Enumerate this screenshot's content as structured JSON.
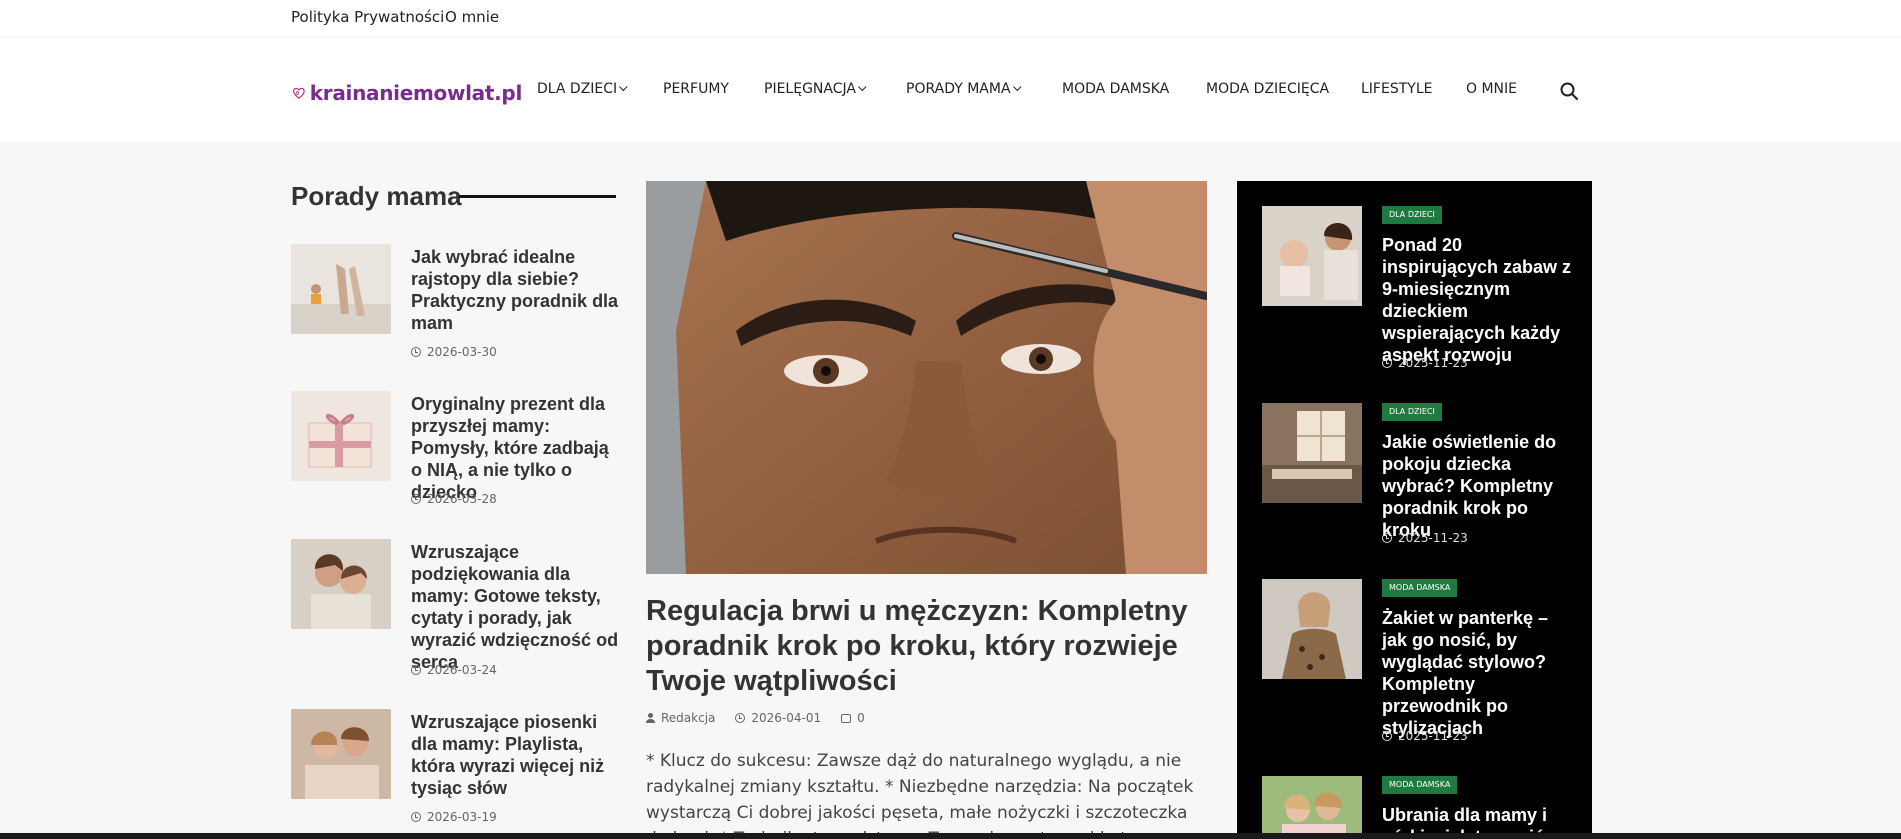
{
  "topbar": {
    "links": [
      "Polityka Prywatności",
      "O mnie"
    ]
  },
  "header": {
    "logo_text": "krainaniemowlat.pl",
    "nav": [
      {
        "label": "DLA DZIECI",
        "dropdown": true
      },
      {
        "label": "PERFUMY",
        "dropdown": false
      },
      {
        "label": "PIELĘGNACJA",
        "dropdown": true
      },
      {
        "label": "PORADY MAMA",
        "dropdown": true
      },
      {
        "label": "MODA DAMSKA",
        "dropdown": false
      },
      {
        "label": "MODA DZIECIĘCA",
        "dropdown": false
      },
      {
        "label": "LIFESTYLE",
        "dropdown": false
      },
      {
        "label": "O MNIE",
        "dropdown": false
      }
    ],
    "search_icon": "search-icon"
  },
  "left": {
    "section_title": "Porady mama",
    "items": [
      {
        "title": "Jak wybrać idealne rajstopy dla siebie? Praktyczny poradnik dla mam",
        "date": "2026-03-30"
      },
      {
        "title": "Oryginalny prezent dla przyszłej mamy: Pomysły, które zadbają o NIĄ, a nie tylko o dziecko",
        "date": "2026-03-28"
      },
      {
        "title": "Wzruszające podziękowania dla mamy: Gotowe teksty, cytaty i porady, jak wyrazić wdzięczność od serca",
        "date": "2026-03-24"
      },
      {
        "title": "Wzruszające piosenki dla mamy: Playlista, która wyrazi więcej niż tysiąc słów",
        "date": "2026-03-19"
      }
    ]
  },
  "main": {
    "title": "Regulacja brwi u mężczyzn: Kompletny poradnik krok po kroku, który rozwieje Twoje wątpliwości",
    "author": "Redakcja",
    "date": "2026-04-01",
    "comments": "0",
    "excerpt": "* Klucz do sukcesu: Zawsze dąż do naturalnego wyglądu, a nie radykalnej zmiany kształtu. * Niezbędne narzędzia: Na początek wystarczą Ci dobrej jakości pęseta, małe nożyczki i szczoteczka do brwi. * Technika to podstawa: Trzymaj pęsetę pod kątem, wyrywaj pojedyncze włoski zgodnie z kierunkiem ich wzrostu."
  },
  "side": {
    "items": [
      {
        "badge": "DLA DZIECI",
        "title": "Ponad 20 inspirujących zabaw z 9-miesięcznym dzieckiem wspierających każdy aspekt rozwoju",
        "date": "2025-11-23"
      },
      {
        "badge": "DLA DZIECI",
        "title": "Jakie oświetlenie do pokoju dziecka wybrać? Kompletny poradnik krok po kroku",
        "date": "2025-11-23"
      },
      {
        "badge": "MODA DAMSKA",
        "title": "Żakiet w panterkę – jak go nosić, by wyglądać stylowo? Kompletny przewodnik po stylizacjach",
        "date": "2025-11-23"
      },
      {
        "badge": "MODA DAMSKA",
        "title": "Ubrania dla mamy i córki – jak to nosić",
        "date": ""
      }
    ]
  },
  "colors": {
    "brand": "#7a2c8e",
    "badge_green": "#1f7a3f",
    "side_bg": "#000000"
  }
}
